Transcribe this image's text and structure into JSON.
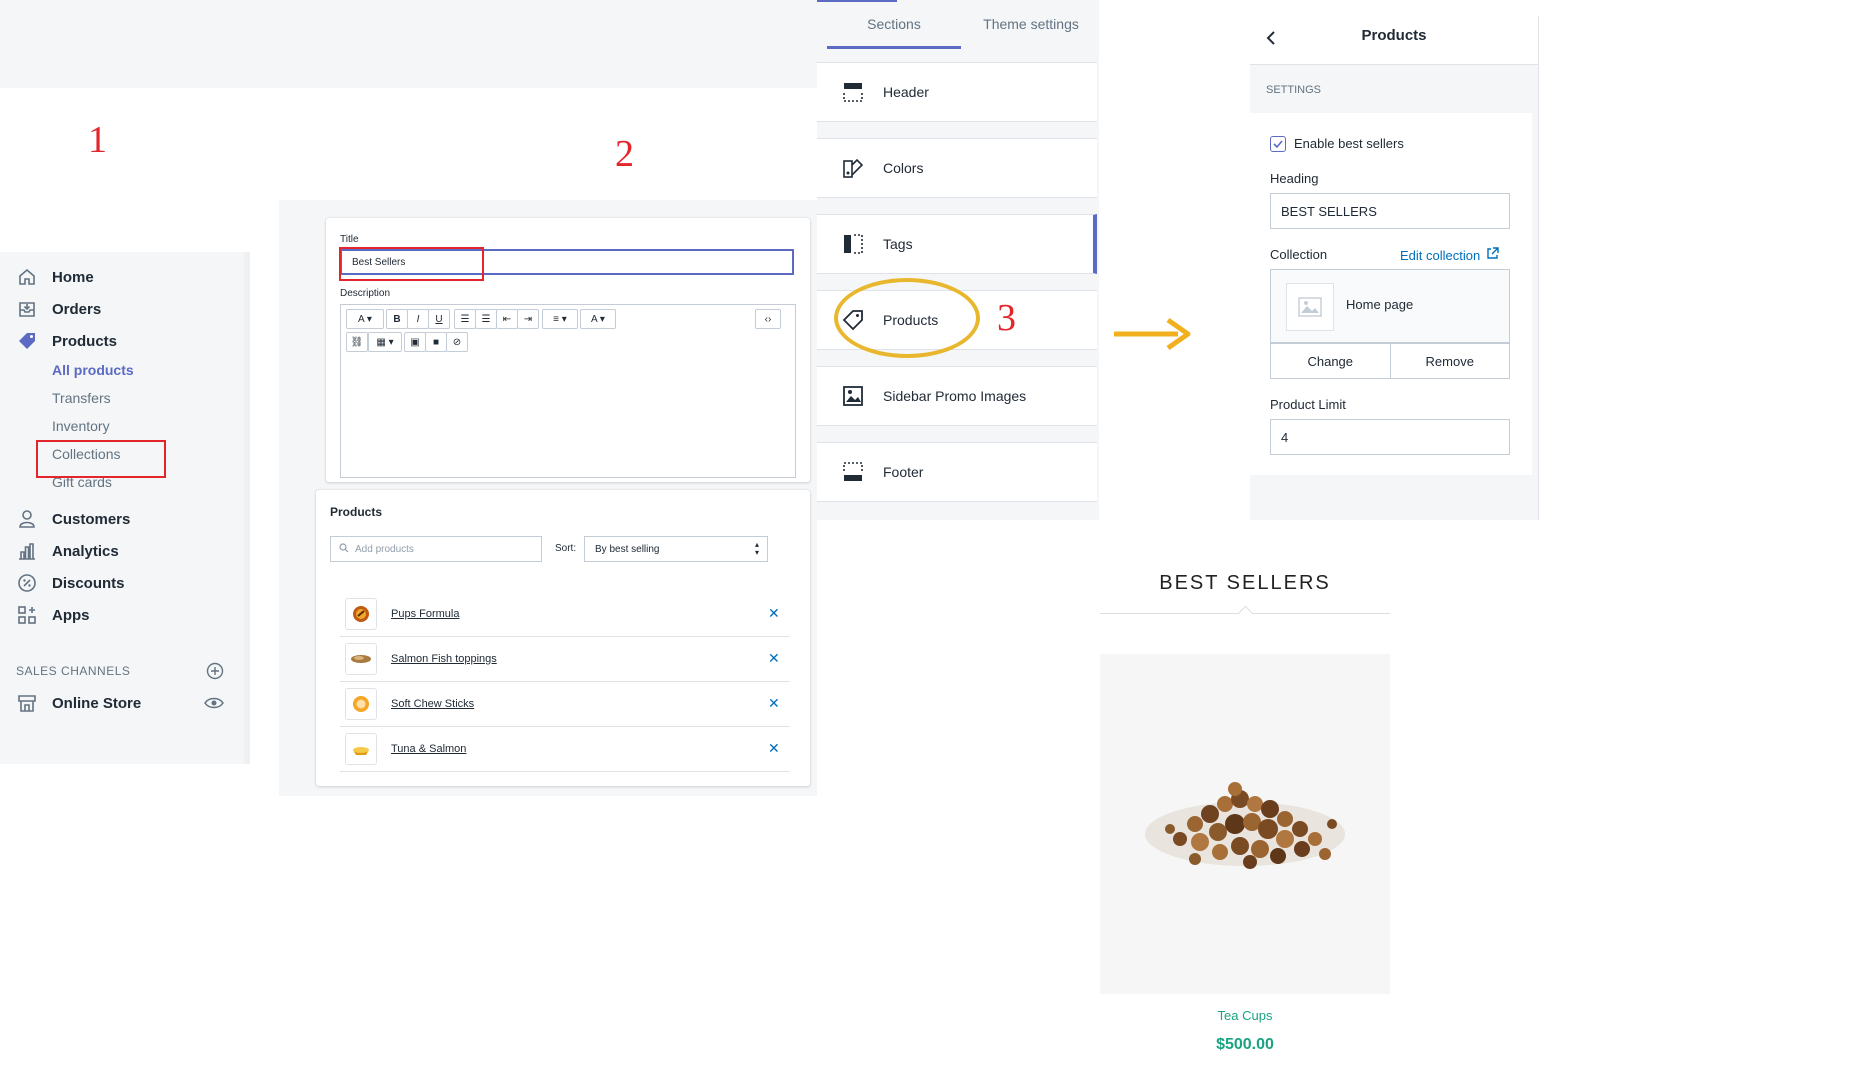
{
  "steps": {
    "one": "1",
    "two": "2",
    "three": "3"
  },
  "sidebar": {
    "items": [
      {
        "label": "Home",
        "icon": "home-icon"
      },
      {
        "label": "Orders",
        "icon": "orders-icon"
      },
      {
        "label": "Products",
        "icon": "tag-icon"
      }
    ],
    "sub_items": [
      {
        "label": "All products"
      },
      {
        "label": "Transfers"
      },
      {
        "label": "Inventory"
      },
      {
        "label": "Collections"
      },
      {
        "label": "Gift cards"
      }
    ],
    "items2": [
      {
        "label": "Customers",
        "icon": "person-icon"
      },
      {
        "label": "Analytics",
        "icon": "chart-icon"
      },
      {
        "label": "Discounts",
        "icon": "discount-icon"
      },
      {
        "label": "Apps",
        "icon": "apps-icon"
      }
    ],
    "sales_channels_label": "SALES CHANNELS",
    "online_store_label": "Online Store"
  },
  "editor": {
    "title_label": "Title",
    "title_value": "Best Sellers",
    "description_label": "Description",
    "products_heading": "Products",
    "search_placeholder": "Add products",
    "sort_label": "Sort:",
    "sort_value": "By best selling",
    "products": [
      {
        "name": "Pups Formula"
      },
      {
        "name": "Salmon Fish toppings"
      },
      {
        "name": "Soft Chew Sticks"
      },
      {
        "name": "Tuna & Salmon"
      }
    ]
  },
  "sections": {
    "tabs": [
      "Sections",
      "Theme settings"
    ],
    "items": [
      {
        "label": "Header",
        "icon": "header-layout-icon"
      },
      {
        "label": "Colors",
        "icon": "colors-icon"
      },
      {
        "label": "Tags",
        "icon": "tags-layout-icon"
      },
      {
        "label": "Products",
        "icon": "tag-icon"
      },
      {
        "label": "Sidebar Promo Images",
        "icon": "image-icon"
      },
      {
        "label": "Footer",
        "icon": "footer-layout-icon"
      }
    ]
  },
  "settings": {
    "title": "Products",
    "section_label": "SETTINGS",
    "enable_label": "Enable best sellers",
    "enable_checked": true,
    "heading_label": "Heading",
    "heading_value": "BEST SELLERS",
    "collection_label": "Collection",
    "edit_collection": "Edit collection",
    "collection_name": "Home page",
    "change_button": "Change",
    "remove_button": "Remove",
    "limit_label": "Product Limit",
    "limit_value": "4"
  },
  "storefront": {
    "heading": "BEST SELLERS",
    "product_name": "Tea Cups",
    "product_price": "$500.00"
  },
  "colors": {
    "accent": "#5c6ac4",
    "highlight_red": "#e3262b",
    "circle_gold": "#e8b72d",
    "arrow_gold": "#f2b01e",
    "link_blue": "#006fbb",
    "price_green": "#1aa382"
  }
}
